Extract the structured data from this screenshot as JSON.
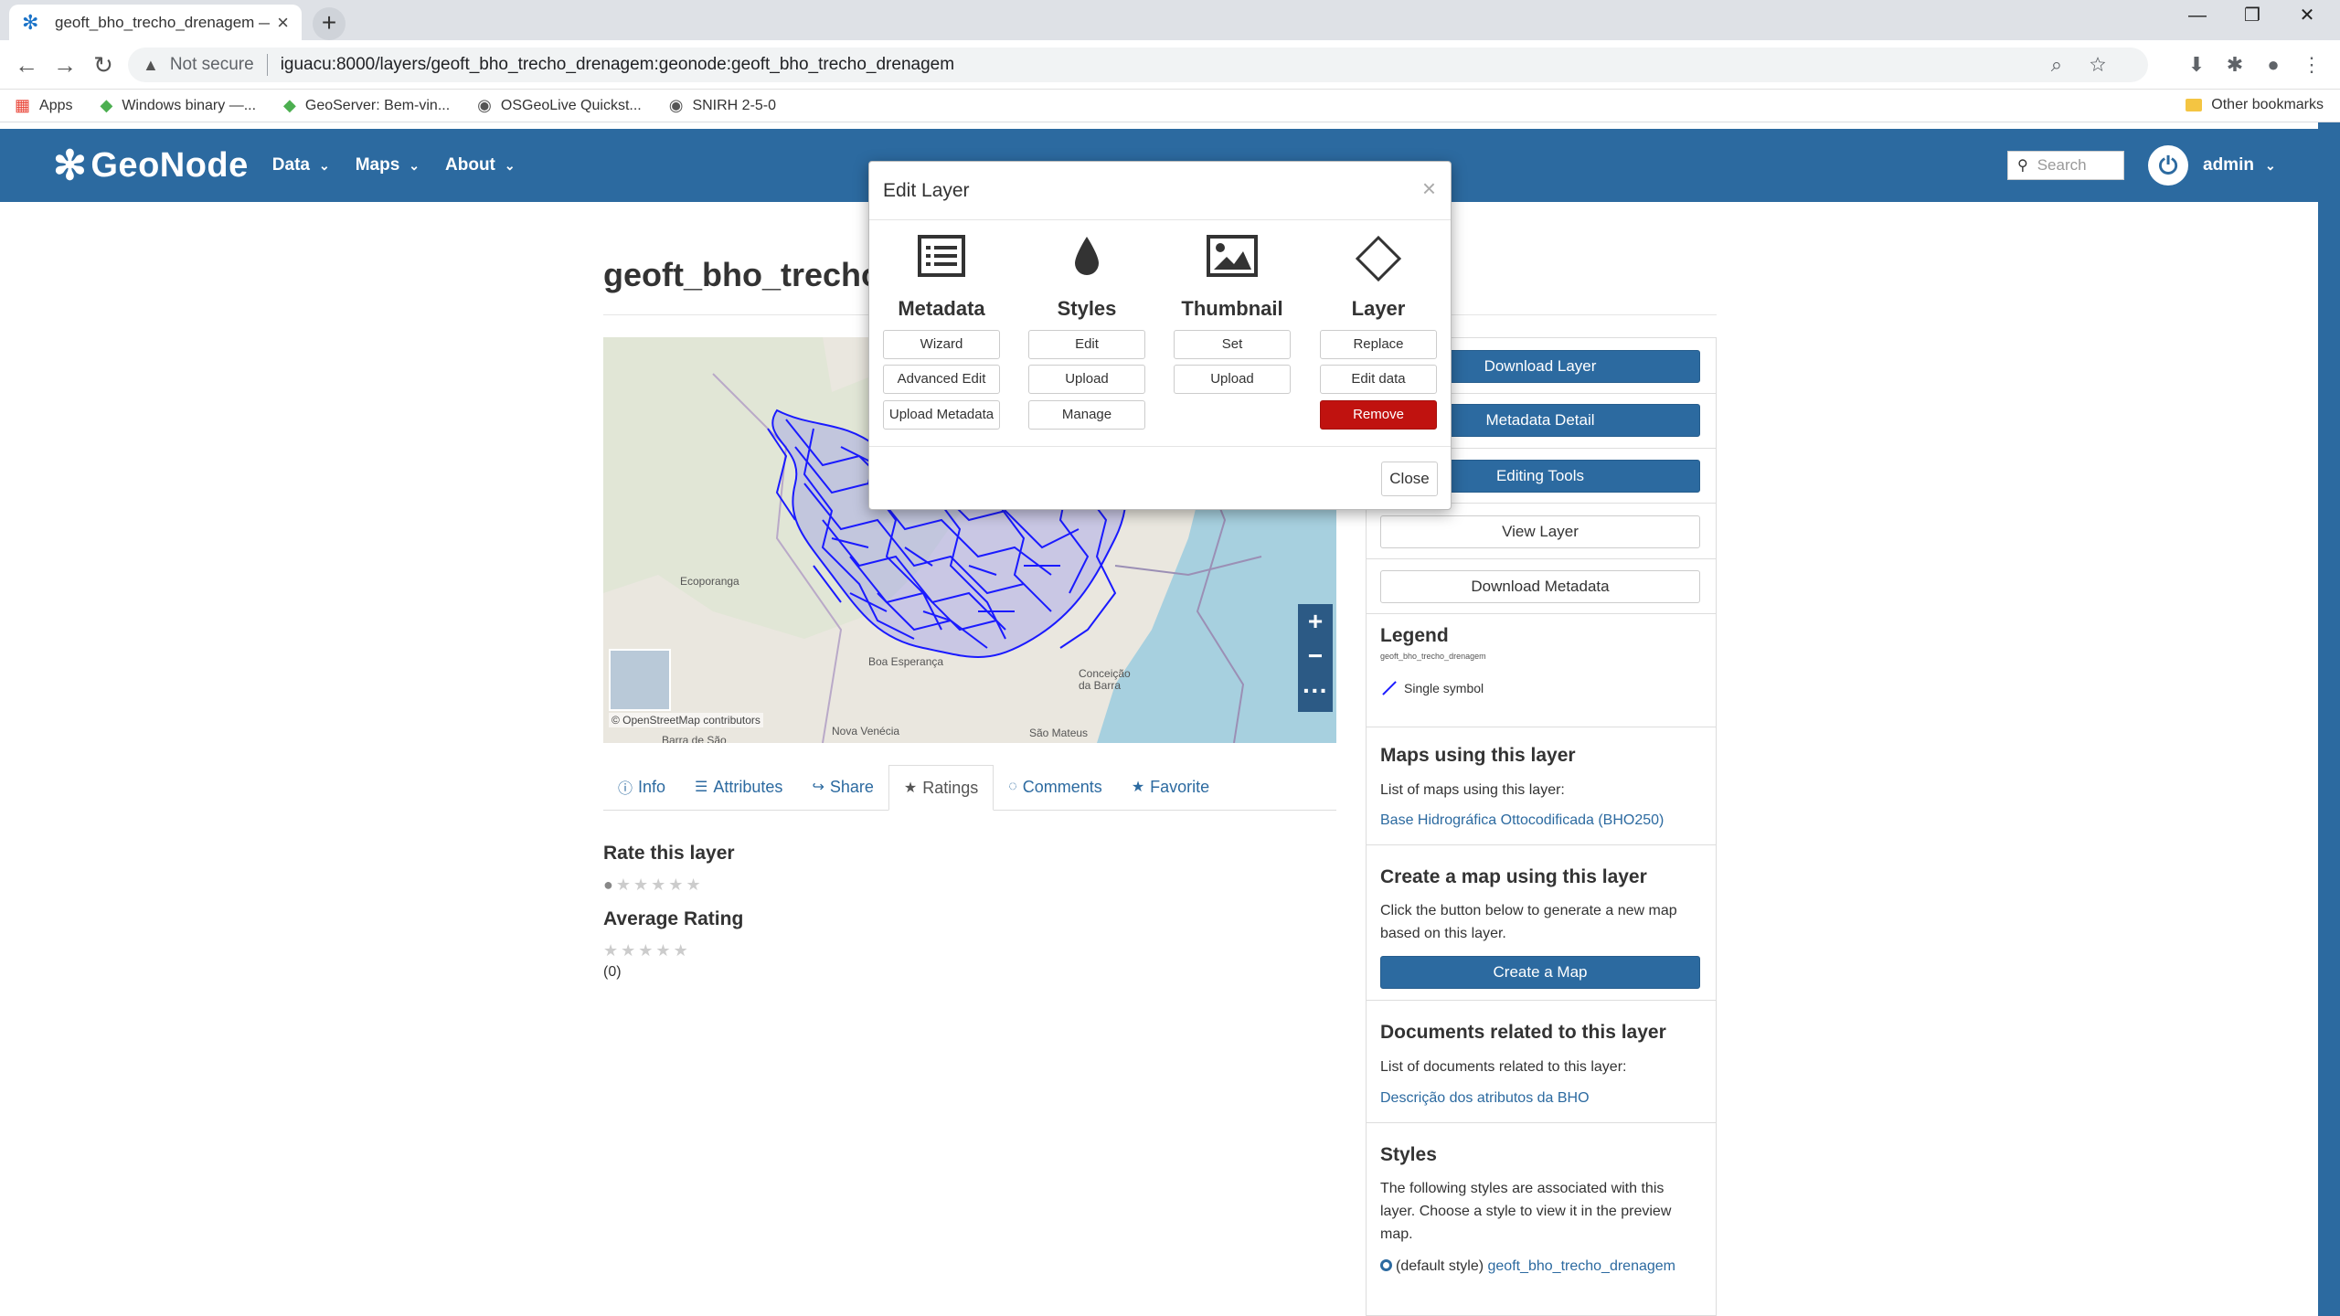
{
  "browser": {
    "tab_title": "geoft_bho_trecho_drenagem — ",
    "address": {
      "security": "Not secure",
      "url": "iguacu:8000/layers/geoft_bho_trecho_drenagem:geonode:geoft_bho_trecho_drenagem"
    },
    "bookmarks": [
      {
        "label": "Apps",
        "icon": "apps-grid-icon"
      },
      {
        "label": "Windows binary —...",
        "icon": "geoserver-icon"
      },
      {
        "label": "GeoServer: Bem-vin...",
        "icon": "geoserver-icon"
      },
      {
        "label": "OSGeoLive Quickst...",
        "icon": "globe-icon"
      },
      {
        "label": "SNIRH 2-5-0",
        "icon": "globe-icon"
      }
    ],
    "other_bookmarks": "Other bookmarks"
  },
  "navbar": {
    "brand": "GeoNode",
    "items": [
      "Data",
      "Maps",
      "About"
    ],
    "search_placeholder": "Search",
    "user": "admin"
  },
  "page": {
    "title": "geoft_bho_trecho_",
    "map": {
      "attribution": "© OpenStreetMap contributors",
      "places": [
        "Ecoporanga",
        "Nova Venécia",
        "São Mateus",
        "Conceição da Barra",
        "Barra de São",
        "Boa Esperança"
      ]
    },
    "tabs": [
      {
        "label": "Info",
        "icon": "info-icon"
      },
      {
        "label": "Attributes",
        "icon": "list-icon"
      },
      {
        "label": "Share",
        "icon": "share-icon"
      },
      {
        "label": "Ratings",
        "icon": "star-icon",
        "active": true
      },
      {
        "label": "Comments",
        "icon": "comment-icon"
      },
      {
        "label": "Favorite",
        "icon": "star-icon"
      }
    ],
    "rate_heading": "Rate this layer",
    "avg_heading": "Average Rating",
    "rating_count": "(0)",
    "rating_value": 0
  },
  "sidebar": {
    "download_layer": "Download Layer",
    "metadata_detail": "Metadata Detail",
    "editing_tools": "Editing Tools",
    "view_layer": "View Layer",
    "download_metadata": "Download Metadata",
    "legend": {
      "heading": "Legend",
      "layer_name": "geoft_bho_trecho_drenagem",
      "item": "Single symbol"
    },
    "maps_using": {
      "heading": "Maps using this layer",
      "text": "List of maps using this layer:",
      "link": "Base Hidrográfica Ottocodificada (BHO250)"
    },
    "create_map": {
      "heading": "Create a map using this layer",
      "text": "Click the button below to generate a new map based on this layer.",
      "button": "Create a Map"
    },
    "documents": {
      "heading": "Documents related to this layer",
      "text": "List of documents related to this layer:",
      "link": "Descrição dos atributos da BHO"
    },
    "styles": {
      "heading": "Styles",
      "text": "The following styles are associated with this layer. Choose a style to view it in the preview map.",
      "default_label": "(default style)",
      "link": "geoft_bho_trecho_drenagem"
    }
  },
  "modal": {
    "title": "Edit Layer",
    "close": "Close",
    "columns": [
      {
        "heading": "Metadata",
        "icon": "list-doc-icon",
        "buttons": [
          "Wizard",
          "Advanced Edit",
          "Upload Metadata"
        ]
      },
      {
        "heading": "Styles",
        "icon": "droplet-icon",
        "buttons": [
          "Edit",
          "Upload",
          "Manage"
        ]
      },
      {
        "heading": "Thumbnail",
        "icon": "image-icon",
        "buttons": [
          "Set",
          "Upload"
        ]
      },
      {
        "heading": "Layer",
        "icon": "diamond-icon",
        "buttons": [
          "Replace",
          "Edit data",
          "Remove"
        ]
      }
    ]
  },
  "colors": {
    "navbar": "#2c6aa0",
    "danger": "#c0120f",
    "river": "#1a1aff",
    "sea": "#a7d0df"
  }
}
